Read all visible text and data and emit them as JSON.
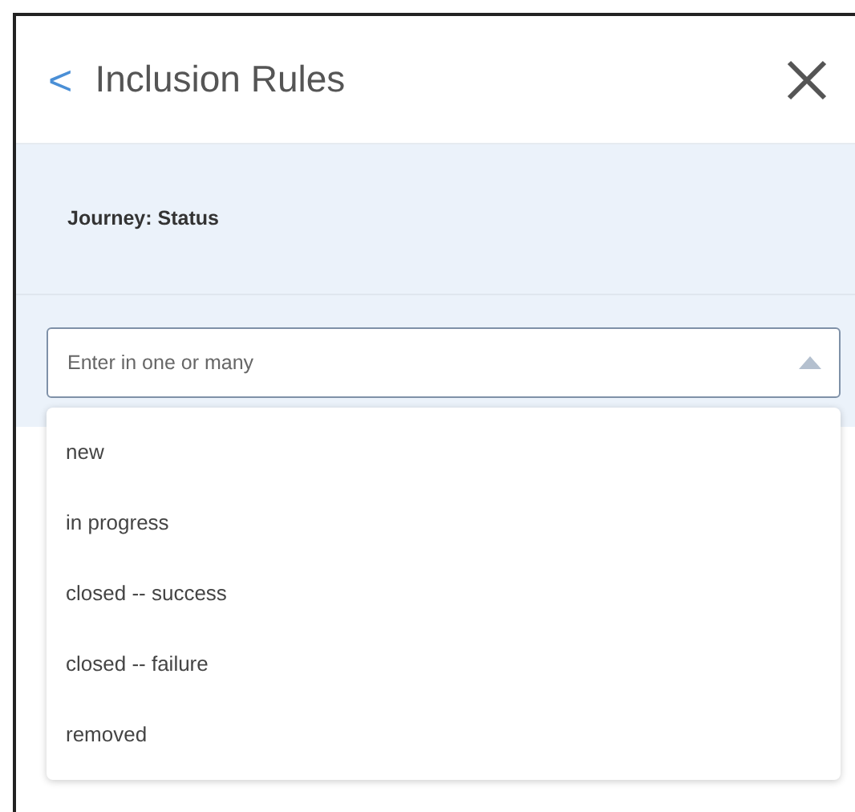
{
  "header": {
    "back": "<",
    "title": "Inclusion Rules"
  },
  "filter": {
    "label": "Journey: Status",
    "placeholder": "Enter in one or many",
    "expanded": true
  },
  "options": [
    {
      "label": "new"
    },
    {
      "label": "in progress"
    },
    {
      "label": "closed -- success"
    },
    {
      "label": "closed -- failure"
    },
    {
      "label": "removed"
    }
  ]
}
